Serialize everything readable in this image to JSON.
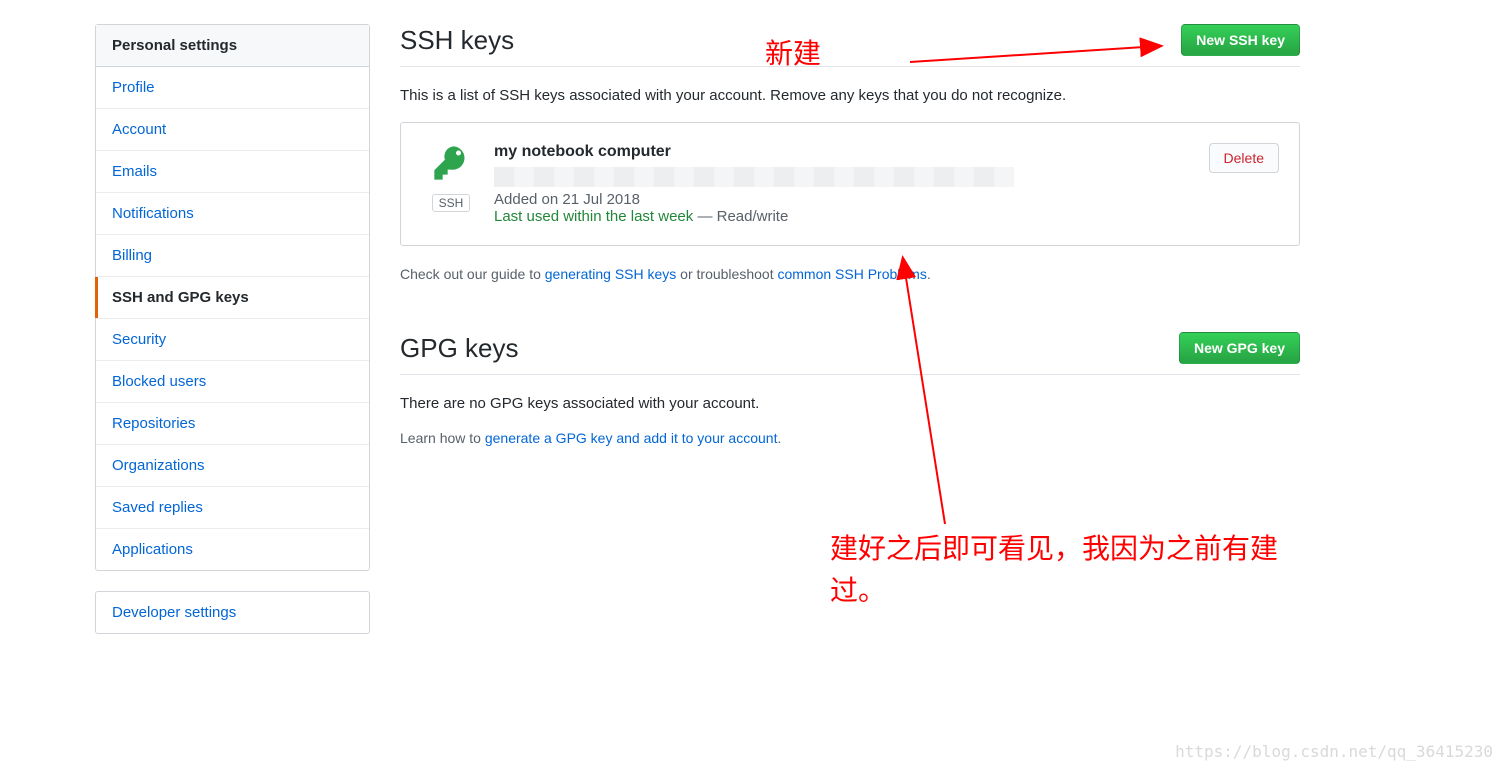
{
  "sidebar": {
    "header": "Personal settings",
    "items": [
      "Profile",
      "Account",
      "Emails",
      "Notifications",
      "Billing",
      "SSH and GPG keys",
      "Security",
      "Blocked users",
      "Repositories",
      "Organizations",
      "Saved replies",
      "Applications"
    ],
    "developer": "Developer settings"
  },
  "ssh": {
    "title": "SSH keys",
    "new_btn": "New SSH key",
    "description": "This is a list of SSH keys associated with your account. Remove any keys that you do not recognize.",
    "key": {
      "title": "my notebook computer",
      "badge": "SSH",
      "added": "Added on 21 Jul 2018",
      "last_used_green": "Last used within the last week",
      "last_used_sep": " — ",
      "last_used_mode": "Read/write",
      "delete": "Delete"
    },
    "guide_prefix": "Check out our guide to ",
    "guide_link1": "generating SSH keys",
    "guide_mid": " or troubleshoot ",
    "guide_link2": "common SSH Problems",
    "guide_suffix": "."
  },
  "gpg": {
    "title": "GPG keys",
    "new_btn": "New GPG key",
    "description": "There are no GPG keys associated with your account.",
    "learn_prefix": "Learn how to ",
    "learn_link": "generate a GPG key and add it to your account",
    "learn_suffix": "."
  },
  "annotations": {
    "new": "新建",
    "built": "建好之后即可看见，我因为之前有建过。"
  },
  "watermark": "https://blog.csdn.net/qq_36415230"
}
